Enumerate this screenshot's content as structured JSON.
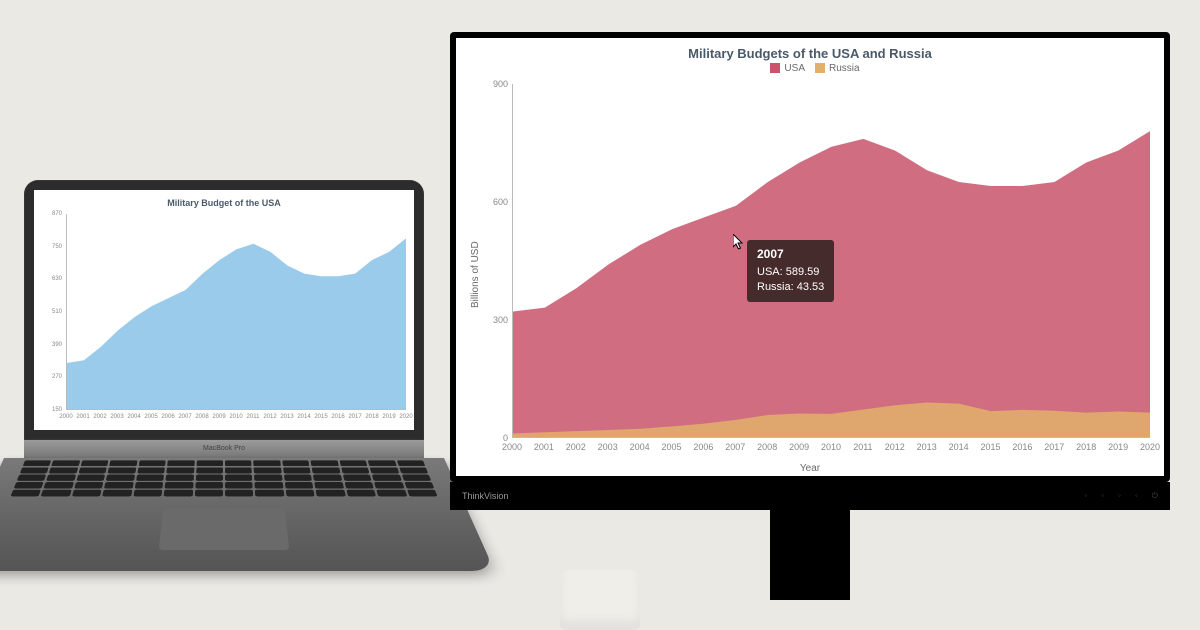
{
  "scene": {
    "laptop_brand": "MacBook Pro",
    "monitor_brand": "ThinkVision"
  },
  "chart_left": {
    "title": "Military Budget of the USA",
    "ylim": [
      150,
      870
    ],
    "yticks": [
      150,
      270,
      390,
      510,
      630,
      750,
      870
    ],
    "categories": [
      "2000",
      "2001",
      "2002",
      "2003",
      "2004",
      "2005",
      "2006",
      "2007",
      "2008",
      "2009",
      "2010",
      "2011",
      "2012",
      "2013",
      "2014",
      "2015",
      "2016",
      "2017",
      "2018",
      "2019",
      "2020"
    ]
  },
  "chart_right": {
    "title": "Military Budgets of the USA and Russia",
    "xlabel": "Year",
    "ylabel": "Billions of USD",
    "ylim": [
      0,
      900
    ],
    "yticks": [
      0,
      300,
      600,
      900
    ],
    "categories": [
      "2000",
      "2001",
      "2002",
      "2003",
      "2004",
      "2005",
      "2006",
      "2007",
      "2008",
      "2009",
      "2010",
      "2011",
      "2012",
      "2013",
      "2014",
      "2015",
      "2016",
      "2017",
      "2018",
      "2019",
      "2020"
    ],
    "legend": [
      {
        "name": "USA",
        "color": "#c9546b"
      },
      {
        "name": "Russia",
        "color": "#e2b06a"
      }
    ],
    "tooltip": {
      "year": "2007",
      "lines": [
        "USA: 589.59",
        "Russia: 43.53"
      ]
    }
  },
  "chart_data": [
    {
      "type": "area",
      "title": "Military Budget of the USA",
      "xlabel": "",
      "ylabel": "",
      "categories": [
        "2000",
        "2001",
        "2002",
        "2003",
        "2004",
        "2005",
        "2006",
        "2007",
        "2008",
        "2009",
        "2010",
        "2011",
        "2012",
        "2013",
        "2014",
        "2015",
        "2016",
        "2017",
        "2018",
        "2019",
        "2020"
      ],
      "series": [
        {
          "name": "USA",
          "color": "#8fc5e8",
          "values": [
            320,
            330,
            380,
            440,
            490,
            530,
            560,
            590,
            650,
            700,
            740,
            760,
            730,
            680,
            650,
            640,
            640,
            650,
            700,
            730,
            780
          ]
        }
      ],
      "ylim": [
        150,
        870
      ]
    },
    {
      "type": "area",
      "title": "Military Budgets of the USA and Russia",
      "xlabel": "Year",
      "ylabel": "Billions of USD",
      "categories": [
        "2000",
        "2001",
        "2002",
        "2003",
        "2004",
        "2005",
        "2006",
        "2007",
        "2008",
        "2009",
        "2010",
        "2011",
        "2012",
        "2013",
        "2014",
        "2015",
        "2016",
        "2017",
        "2018",
        "2019",
        "2020"
      ],
      "series": [
        {
          "name": "USA",
          "color": "#c9546b",
          "values": [
            320,
            330,
            380,
            440,
            490,
            530,
            560,
            589.59,
            650,
            700,
            740,
            760,
            730,
            680,
            650,
            640,
            640,
            650,
            700,
            730,
            780
          ]
        },
        {
          "name": "Russia",
          "color": "#e2b06a",
          "values": [
            9,
            12,
            15,
            18,
            21,
            27,
            34,
            43.53,
            56,
            60,
            59,
            70,
            81,
            88,
            85,
            66,
            69,
            67,
            62,
            65,
            62
          ]
        }
      ],
      "ylim": [
        0,
        900
      ],
      "legend_position": "top",
      "tooltip_sample": {
        "x": "2007",
        "USA": 589.59,
        "Russia": 43.53
      }
    }
  ]
}
